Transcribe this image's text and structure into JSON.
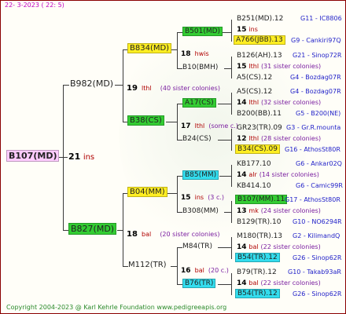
{
  "header": {
    "date": "22-  3-2023  (  22:   5)"
  },
  "footer": {
    "text": "Copyright 2004-2023 @ Karl Kehrle Foundation    www.pedigreeapis.org"
  },
  "tree": {
    "root": {
      "id": "B107(MD)",
      "num": "21",
      "loc": "ins"
    },
    "gen2": [
      {
        "id": "B982(MD)",
        "num": "19",
        "loc": "lthl",
        "sis": "(40 sister colonies)"
      },
      {
        "id": "B827(MD)",
        "num": "18",
        "loc": "bal",
        "sis": "(20 sister colonies)"
      }
    ],
    "gen3": [
      {
        "id": "B834(MD)",
        "num": "18",
        "loc": "hwis"
      },
      {
        "id": "B38(CS)",
        "num": "17",
        "loc": "lthl",
        "sis": "(some c.)"
      },
      {
        "id": "B04(MM)",
        "num": "15",
        "loc": "ins",
        "sis": "(3 c.)"
      },
      {
        "id": "M112(TR)",
        "num": "16",
        "loc": "bal",
        "sis": "(20 c.)"
      }
    ],
    "gen4": [
      "B501(MD)",
      "B10(BMH)",
      "A17(CS)",
      "B24(CS)",
      "B85(MM)",
      "B308(MM)",
      "M84(TR)",
      "B76(TR)"
    ],
    "gen5": [
      {
        "id": "B251(MD).12",
        "q": "G11 - IC8806"
      },
      {
        "num": "15",
        "loc": "ins"
      },
      {
        "id": "A766(JBB).13",
        "q": "G9 - Cankiri97Q"
      },
      {
        "id": "B126(AH).13",
        "q": "G21 - Sinop72R"
      },
      {
        "num": "15",
        "loc": "lthl",
        "sis": "(31 sister colonies)"
      },
      {
        "id": "A5(CS).12",
        "q": "G4 - Bozdag07R"
      },
      {
        "id": "A5(CS).12",
        "q": "G4 - Bozdag07R"
      },
      {
        "num": "14",
        "loc": "lthl",
        "sis": "(32 sister colonies)"
      },
      {
        "id": "B200(BB).11",
        "q": "G5 - B200(NE)"
      },
      {
        "id": "GR23(TR).09",
        "q": "G3 - Gr.R.mounta"
      },
      {
        "num": "12",
        "loc": "lthl",
        "sis": "(28 sister colonies)"
      },
      {
        "id": "B34(CS).09",
        "q": "G16 - AthosSt80R"
      },
      {
        "id": "KB177.10",
        "q": "G6 - Ankar02Q"
      },
      {
        "num": "14",
        "loc": "alr",
        "sis": "(14 sister colonies)"
      },
      {
        "id": "KB414.10",
        "q": "G6 - Camic99R"
      },
      {
        "id": "B107(MM).11",
        "q": "G17 - AthosSt80R"
      },
      {
        "num": "13",
        "loc": "mk",
        "sis": "(24 sister colonies)"
      },
      {
        "id": "B129(TR).10",
        "q": "G10 - NO6294R"
      },
      {
        "id": "M180(TR).13",
        "q": "G2 - KilimandQ"
      },
      {
        "num": "14",
        "loc": "bal",
        "sis": "(22 sister colonies)"
      },
      {
        "id": "B54(TR).12",
        "q": "G26 - Sinop62R"
      },
      {
        "id": "B79(TR).12",
        "q": "G10 - Takab93aR"
      },
      {
        "num": "14",
        "loc": "bal",
        "sis": "(22 sister colonies)"
      },
      {
        "id": "B54(TR).12",
        "q": "G26 - Sinop62R"
      }
    ]
  },
  "colors": {
    "pink": "#ffccff",
    "green": "#33cc33",
    "yellow": "#ffee22",
    "cyan": "#33ddee",
    "location": "#b00000",
    "sister": "#7a1ea0",
    "queen_ref": "#1e1ec8",
    "border": "#8a0000"
  }
}
